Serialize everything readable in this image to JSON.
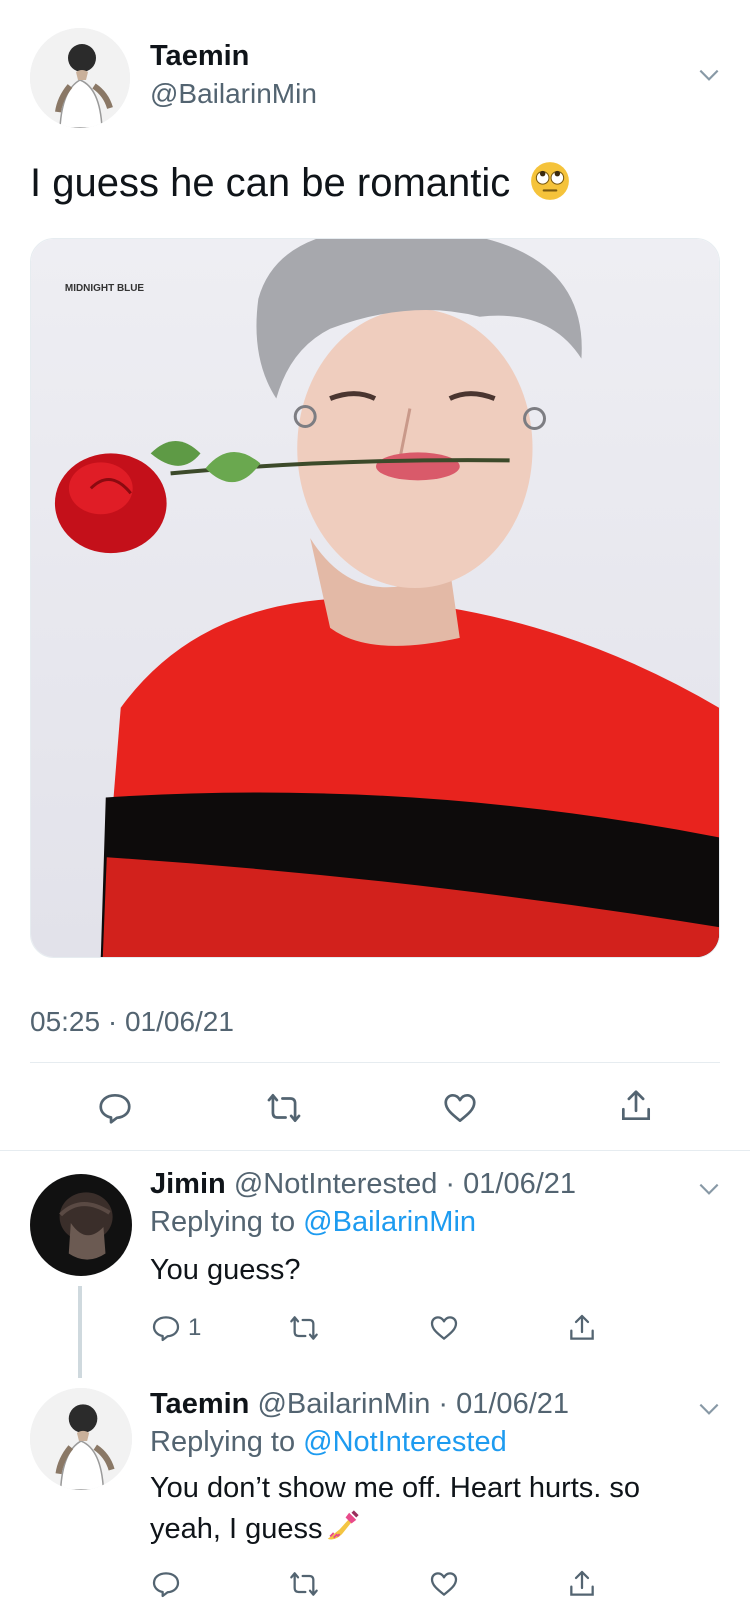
{
  "main_tweet": {
    "author_name": "Taemin",
    "author_handle": "@BailarinMin",
    "text": "I guess he can be romantic",
    "text_emoji": "face-with-rolling-eyes",
    "media": {
      "watermark": "MIDNIGHT BLUE",
      "description_icon": "photo-person-with-rose"
    },
    "timestamp": "05:25 · 01/06/21",
    "actions": [
      "reply-icon",
      "retweet-icon",
      "like-icon",
      "share-icon"
    ]
  },
  "replies": [
    {
      "author_name": "Jimin",
      "author_handle": "@NotInterested",
      "date": "· 01/06/21",
      "replying_label": "Replying to",
      "replying_to": "@BailarinMin",
      "text": "You guess?",
      "reply_count": "1"
    },
    {
      "author_name": "Taemin",
      "author_handle": "@BailarinMin",
      "date": "· 01/06/21",
      "replying_label": "Replying to",
      "replying_to": "@NotInterested",
      "text": "You don’t show me off. Heart hurts. so yeah, I guess",
      "text_emoji": "nail-polish"
    }
  ],
  "colors": {
    "text_primary": "#0f1419",
    "text_secondary": "#536471",
    "link": "#1d9bf0",
    "divider": "#e6ecf0"
  }
}
